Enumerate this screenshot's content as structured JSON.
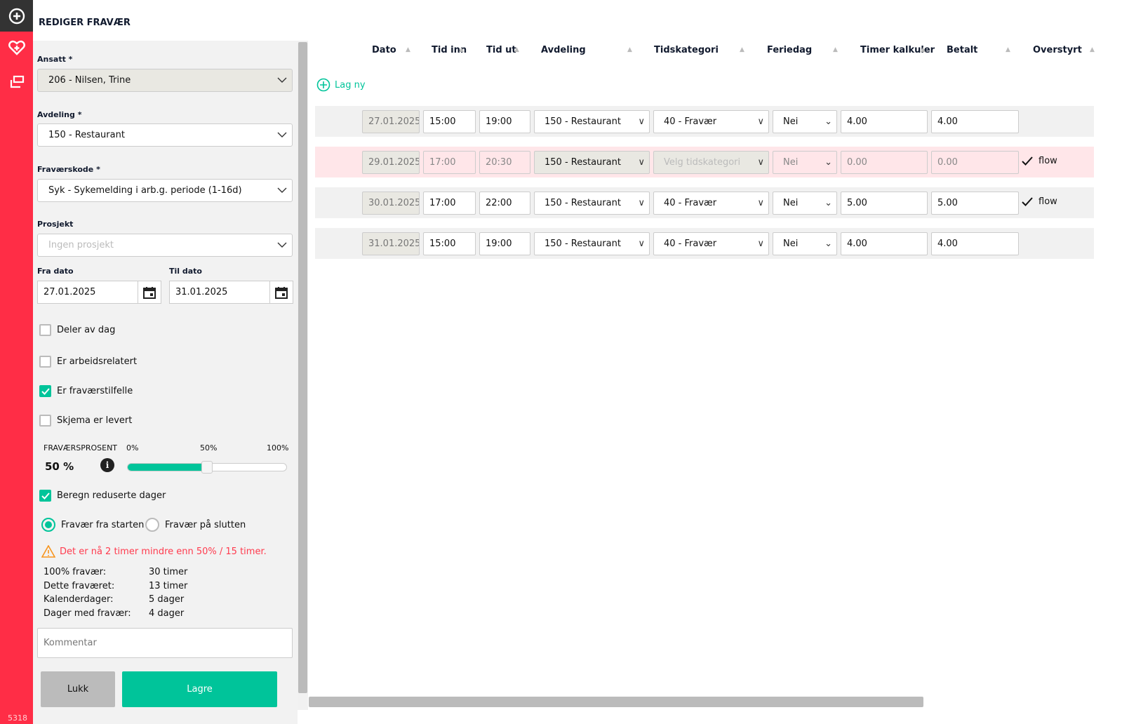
{
  "nav": {
    "version": "5318"
  },
  "title": "REDIGER FRAVÆR",
  "form": {
    "ansatt_label": "Ansatt *",
    "ansatt_value": "206 - Nilsen, Trine",
    "avdeling_label": "Avdeling *",
    "avdeling_value": "150 - Restaurant",
    "fravaerskode_label": "Fraværskode *",
    "fravaerskode_value": "Syk - Sykemelding i arb.g. periode (1-16d)",
    "prosjekt_label": "Prosjekt",
    "prosjekt_placeholder": "Ingen prosjekt",
    "fra_label": "Fra dato",
    "fra_value": "27.01.2025",
    "til_label": "Til dato",
    "til_value": "31.01.2025",
    "checkboxes": [
      {
        "label": "Deler av dag",
        "checked": false
      },
      {
        "label": "Er arbeidsrelatert",
        "checked": false
      },
      {
        "label": "Er fraværstilfelle",
        "checked": true
      },
      {
        "label": "Skjema er levert",
        "checked": false
      }
    ],
    "pct_label": "FRAVÆRSPROSENT",
    "pct_value": "50 %",
    "pct_fraction": 0.5,
    "ticks": [
      "0%",
      "50%",
      "100%"
    ],
    "beregn_label": "Beregn reduserte dager",
    "radio_start": "Fravær fra starten",
    "radio_end": "Fravær på slutten",
    "warning": "Det er nå 2 timer mindre enn 50% / 15 timer.",
    "stats": [
      [
        "100% fravær:",
        "30 timer"
      ],
      [
        "Dette fraværet:",
        "13 timer"
      ],
      [
        "Kalenderdager:",
        "5 dager"
      ],
      [
        "Dager med fravær:",
        "4 dager"
      ]
    ],
    "comment_placeholder": "Kommentar",
    "close_label": "Lukk",
    "save_label": "Lagre"
  },
  "table": {
    "headers": [
      "Dato",
      "Tid inn",
      "Tid ut",
      "Avdeling",
      "Tidskategori",
      "Feriedag",
      "Timer kalkuler",
      "Betalt",
      "Overstyrt"
    ],
    "new_label": "Lag ny",
    "rows": [
      {
        "date": "27.01.2025",
        "in": "15:00",
        "out": "19:00",
        "avd": "150 - Restaurant",
        "kat": "40 - Fravær",
        "ferie": "Nei",
        "timer": "4.00",
        "betalt": "4.00",
        "overstyrt": "",
        "error": false
      },
      {
        "date": "29.01.2025",
        "in": "17:00",
        "out": "20:30",
        "avd": "150 - Restaurant",
        "kat": "Velg tidskategori",
        "ferie": "Nei",
        "timer": "0.00",
        "betalt": "0.00",
        "overstyrt": "flow",
        "error": true
      },
      {
        "date": "30.01.2025",
        "in": "17:00",
        "out": "22:00",
        "avd": "150 - Restaurant",
        "kat": "40 - Fravær",
        "ferie": "Nei",
        "timer": "5.00",
        "betalt": "5.00",
        "overstyrt": "flow",
        "error": false
      },
      {
        "date": "31.01.2025",
        "in": "15:00",
        "out": "19:00",
        "avd": "150 - Restaurant",
        "kat": "40 - Fravær",
        "ferie": "Nei",
        "timer": "4.00",
        "betalt": "4.00",
        "overstyrt": "",
        "error": false
      }
    ]
  },
  "colors": {
    "accent": "#00c49a",
    "brand": "#ff2d46",
    "warning": "#ff3b4e"
  }
}
